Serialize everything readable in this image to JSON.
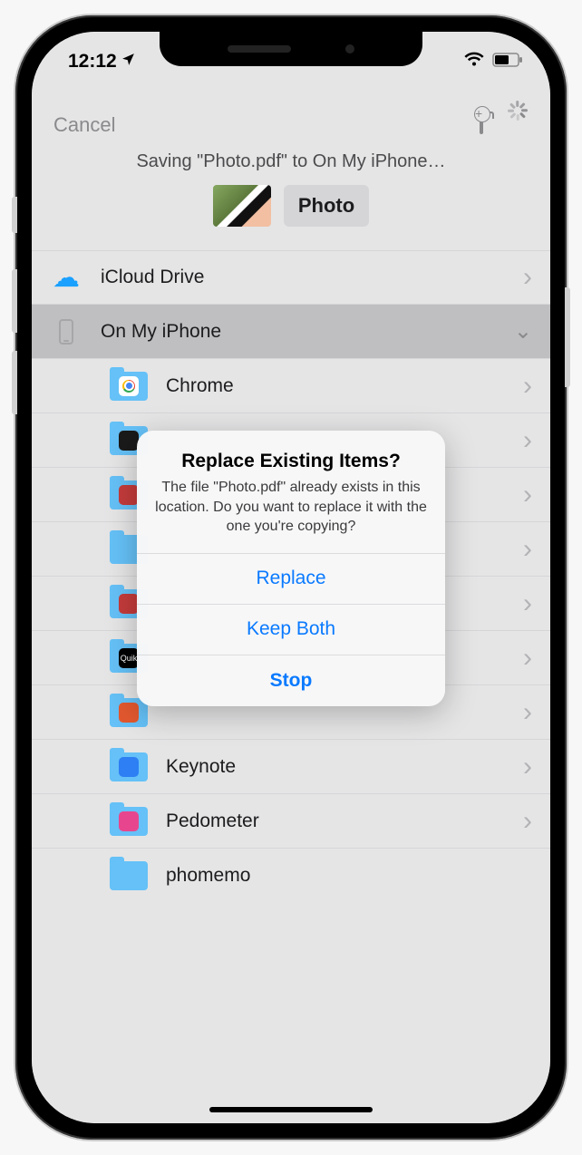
{
  "status": {
    "time": "12:12"
  },
  "nav": {
    "cancel": "Cancel"
  },
  "header": {
    "saving_text": "Saving \"Photo.pdf\" to On My iPhone…",
    "filename_chip": "Photo"
  },
  "locations": {
    "icloud": "iCloud Drive",
    "on_my_iphone": "On My iPhone"
  },
  "folders": [
    {
      "label": "Chrome",
      "badge": "b-chrome"
    },
    {
      "label": "",
      "badge": "b-dark"
    },
    {
      "label": "",
      "badge": "b-red"
    },
    {
      "label": "",
      "badge": ""
    },
    {
      "label": "",
      "badge": "b-red"
    },
    {
      "label": "",
      "badge": "b-quik"
    },
    {
      "label": "",
      "badge": "b-orange"
    },
    {
      "label": "Keynote",
      "badge": "b-blue"
    },
    {
      "label": "Pedometer",
      "badge": "b-pink"
    },
    {
      "label": "phomemo",
      "badge": ""
    }
  ],
  "alert": {
    "title": "Replace Existing Items?",
    "message": "The file \"Photo.pdf\" already exists in this location. Do you want to replace it with the one you're copying?",
    "replace": "Replace",
    "keep_both": "Keep Both",
    "stop": "Stop"
  }
}
